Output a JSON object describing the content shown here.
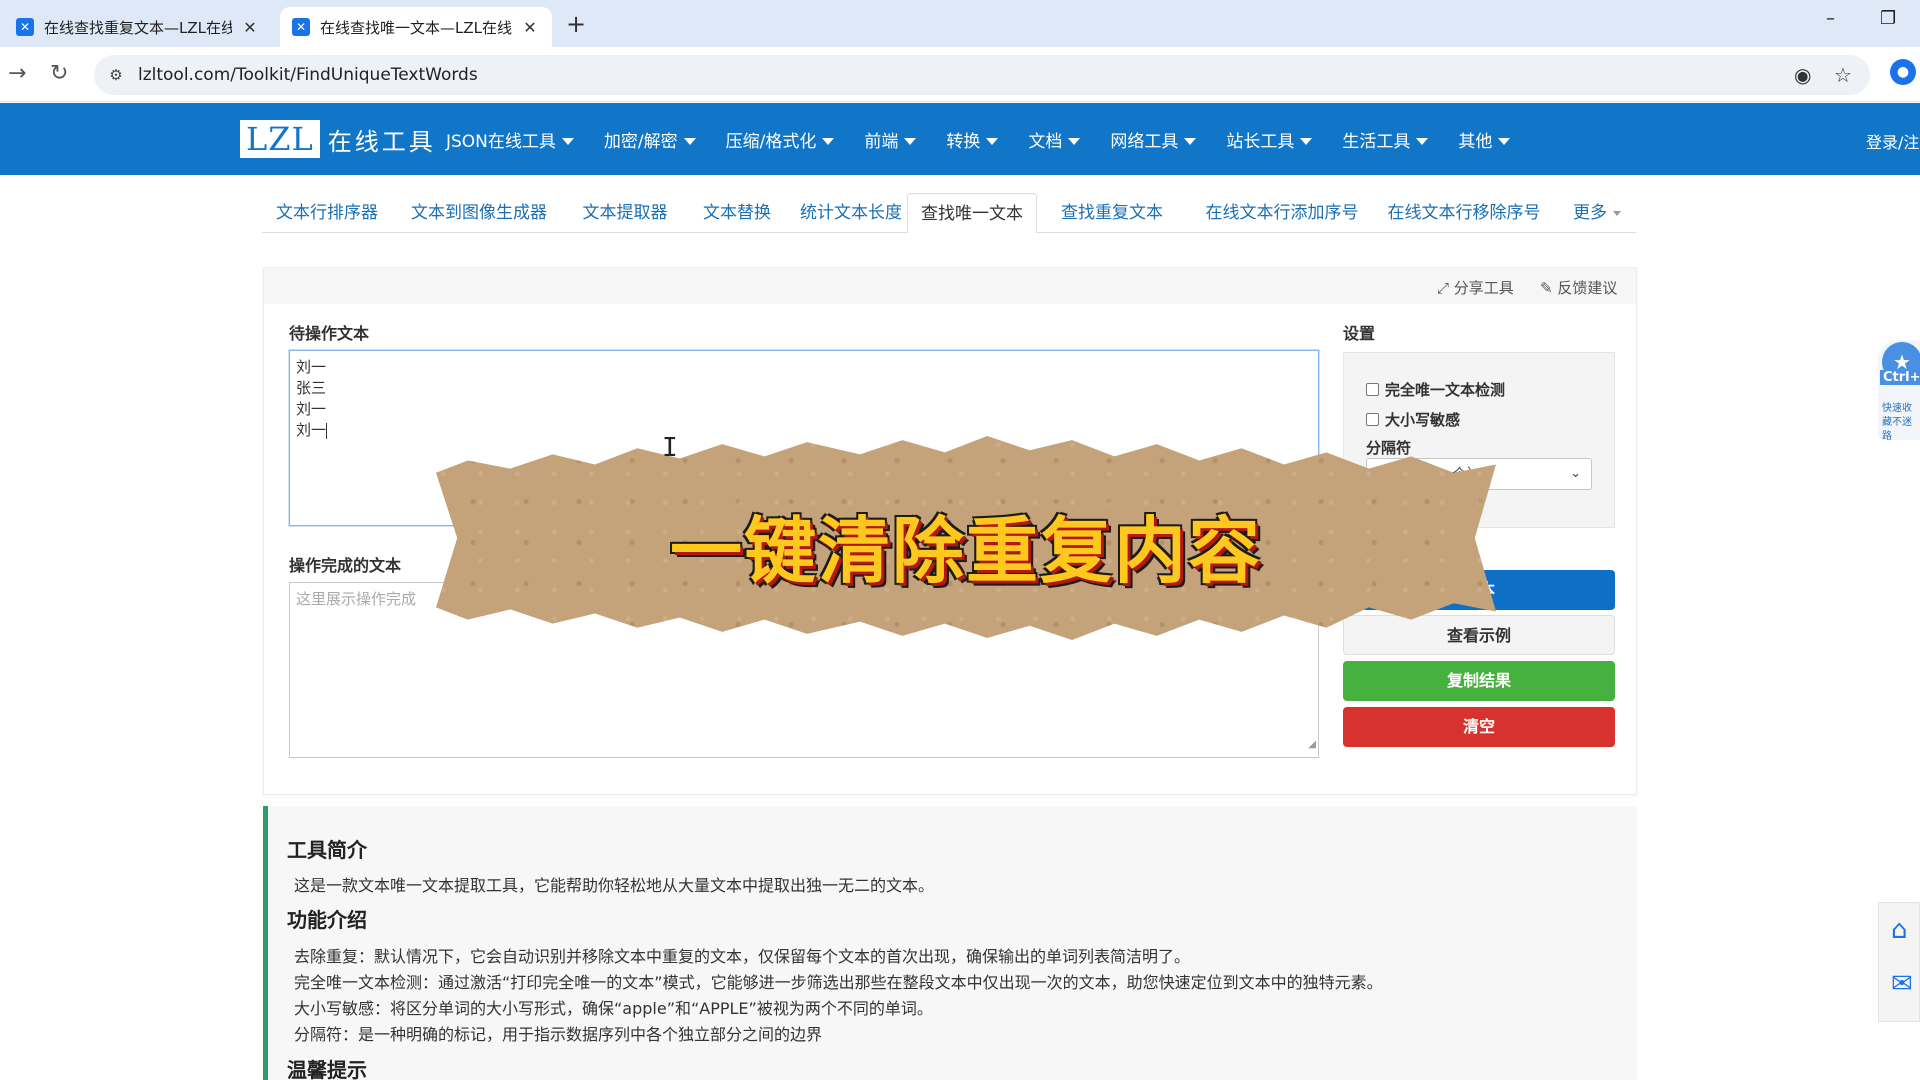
{
  "browser": {
    "tabs": [
      {
        "title": "在线查找重复文本—LZL在线工",
        "active": false
      },
      {
        "title": "在线查找唯一文本—LZL在线工",
        "active": true
      }
    ],
    "new_tab_symbol": "+",
    "address": "lzltool.com/Toolkit/FindUniqueTextWords"
  },
  "site": {
    "logo_box": "LZL",
    "logo_text": "在线工具",
    "menu": [
      "JSON在线工具",
      "加密/解密",
      "压缩/格式化",
      "前端",
      "转换",
      "文档",
      "网络工具",
      "站长工具",
      "生活工具",
      "其他"
    ],
    "login": "登录/注"
  },
  "subtabs": {
    "items": [
      "文本行排序器",
      "文本到图像生成器",
      "文本提取器",
      "文本替换",
      "统计文本长度",
      "查找唯一文本",
      "查找重复文本",
      "在线文本行添加序号",
      "在线文本行移除序号",
      "更多"
    ],
    "current_index": 5
  },
  "tool": {
    "share_label": "分享工具",
    "feedback_label": "反馈建议",
    "input_label": "待操作文本",
    "input_lines": [
      "刘一",
      "张三",
      "刘一",
      "刘一"
    ],
    "output_label": "操作完成的文本",
    "output_placeholder": "这里展示操作完成",
    "settings_label": "设置",
    "option_unique": "完全唯一文本检测",
    "option_case": "大小写敏感",
    "delimiter_label": "分隔符",
    "delimiter_value": "换行符（一个）",
    "buttons": {
      "find": "文本",
      "example": "查看示例",
      "copy": "复制结果",
      "clear": "清空"
    }
  },
  "info": {
    "intro_title": "工具简介",
    "intro_text": "这是一款文本唯一文本提取工具，它能帮助你轻松地从大量文本中提取出独一无二的文本。",
    "features_title": "功能介绍",
    "features": [
      "去除重复：默认情况下，它会自动识别并移除文本中重复的文本，仅保留每个文本的首次出现，确保输出的单词列表简洁明了。",
      "完全唯一文本检测：通过激活“打印完全唯一的文本”模式，它能够进一步筛选出那些在整段文本中仅出现一次的文本，助您快速定位到文本中的独特元素。",
      "大小写敏感：将区分单词的大小写形式，确保“apple”和“APPLE”被视为两个不同的单词。",
      "分隔符：是一种明确的标记，用于指示数据序列中各个独立部分之间的边界"
    ],
    "tips_title": "温馨提示"
  },
  "floating": {
    "fav_label": "Ctrl+",
    "fav_note": "快速收藏不迷路"
  },
  "overlay": {
    "caption": "一键清除重复内容"
  },
  "colors": {
    "header_blue": "#1176c8",
    "button_blue": "#0e6fc6",
    "button_green": "#46b13e",
    "button_red": "#d8322e",
    "accent_green": "#2a9d6a",
    "caption_yellow": "#ffc81e"
  }
}
